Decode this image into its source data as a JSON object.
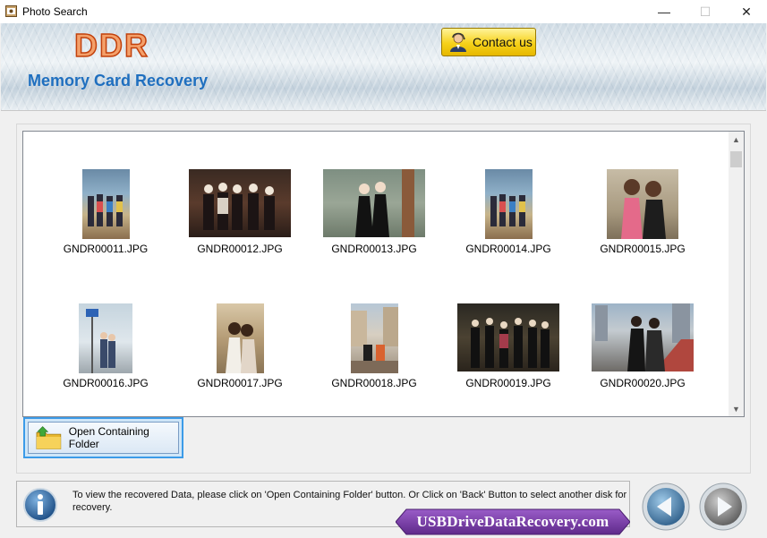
{
  "window": {
    "title": "Photo Search",
    "minimize_glyph": "—",
    "maximize_glyph": "☐",
    "close_glyph": "✕"
  },
  "header": {
    "logo_text": "DDR",
    "product_title": "Memory Card Recovery",
    "contact_label": "Contact us"
  },
  "gallery": {
    "items": [
      {
        "filename": "GNDR00011.JPG"
      },
      {
        "filename": "GNDR00012.JPG"
      },
      {
        "filename": "GNDR00013.JPG"
      },
      {
        "filename": "GNDR00014.JPG"
      },
      {
        "filename": "GNDR00015.JPG"
      },
      {
        "filename": "GNDR00016.JPG"
      },
      {
        "filename": "GNDR00017.JPG"
      },
      {
        "filename": "GNDR00018.JPG"
      },
      {
        "filename": "GNDR00019.JPG"
      },
      {
        "filename": "GNDR00020.JPG"
      }
    ]
  },
  "actions": {
    "open_folder_label": "Open Containing Folder"
  },
  "info": {
    "message": "To view the recovered Data, please click on 'Open Containing Folder' button. Or Click on 'Back' Button to select another disk for recovery."
  },
  "banner": {
    "text": "USBDriveDataRecovery.com"
  },
  "colors": {
    "accent": "#1f6fbf",
    "logo": "#f4a06a",
    "banner": "#7a3aa8",
    "selection_border": "#3c9be8"
  }
}
